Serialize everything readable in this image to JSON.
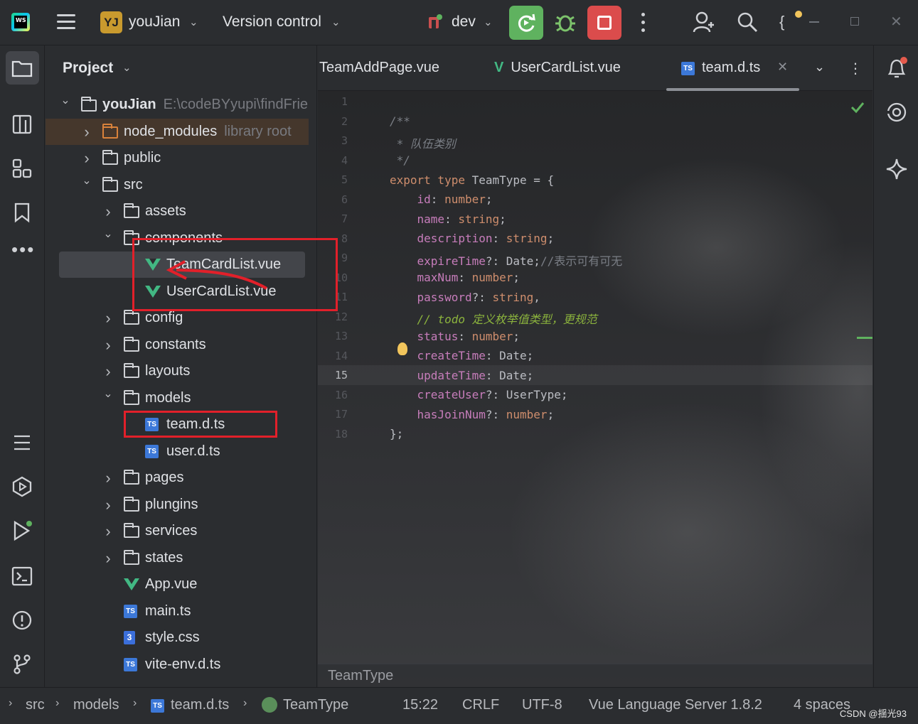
{
  "toolbar": {
    "app_logo_text": "WS",
    "project_badge": "YJ",
    "project_name": "youJian",
    "vcs_label": "Version control",
    "branch": "dev"
  },
  "project_panel": {
    "title": "Project",
    "tree": [
      {
        "label": "youJian",
        "hint": "E:\\codeBYyupi\\findFrie",
        "kind": "folder",
        "expanded": true,
        "bold": true
      },
      {
        "label": "node_modules",
        "hint": "library root",
        "kind": "folder-orange",
        "expanded": false
      },
      {
        "label": "public",
        "kind": "folder",
        "expanded": false
      },
      {
        "label": "src",
        "kind": "folder",
        "expanded": true
      },
      {
        "label": "assets",
        "kind": "folder",
        "expanded": false
      },
      {
        "label": "components",
        "kind": "folder",
        "expanded": true
      },
      {
        "label": "TeamCardList.vue",
        "kind": "vue"
      },
      {
        "label": "UserCardList.vue",
        "kind": "vue"
      },
      {
        "label": "config",
        "kind": "folder",
        "expanded": false
      },
      {
        "label": "constants",
        "kind": "folder",
        "expanded": false
      },
      {
        "label": "layouts",
        "kind": "folder",
        "expanded": false
      },
      {
        "label": "models",
        "kind": "folder",
        "expanded": true
      },
      {
        "label": "team.d.ts",
        "kind": "ts"
      },
      {
        "label": "user.d.ts",
        "kind": "ts"
      },
      {
        "label": "pages",
        "kind": "folder",
        "expanded": false
      },
      {
        "label": "plungins",
        "kind": "folder",
        "expanded": false
      },
      {
        "label": "services",
        "kind": "folder",
        "expanded": false
      },
      {
        "label": "states",
        "kind": "folder",
        "expanded": false
      },
      {
        "label": "App.vue",
        "kind": "vue"
      },
      {
        "label": "main.ts",
        "kind": "ts"
      },
      {
        "label": "style.css",
        "kind": "css"
      },
      {
        "label": "vite-env.d.ts",
        "kind": "ts"
      }
    ]
  },
  "editor": {
    "tabs": [
      {
        "label": "TeamAddPage.vue",
        "kind": "vue"
      },
      {
        "label": "UserCardList.vue",
        "kind": "vue"
      },
      {
        "label": "team.d.ts",
        "kind": "ts",
        "active": true
      }
    ],
    "line_numbers": [
      "1",
      "2",
      "3",
      "4",
      "5",
      "6",
      "7",
      "8",
      "9",
      "10",
      "11",
      "12",
      "13",
      "14",
      "15",
      "16",
      "17",
      "18"
    ],
    "current_line": "15",
    "code": {
      "l2": "/**",
      "l3_a": " * ",
      "l3_b": "队伍类别",
      "l4": " */",
      "l5_kw": "export type ",
      "l5_rest": "TeamType = {",
      "l6_p": "id",
      "l6_t": "number",
      "l7_p": "name",
      "l7_t": "string",
      "l8_p": "description",
      "l8_t": "string",
      "l9_p": "expireTime",
      "l9_t": "Date",
      "l9_c": "//表示可有可无",
      "l10_p": "maxNum",
      "l10_t": "number",
      "l11_p": "password",
      "l11_t": "string",
      "l12": "// todo 定义枚举值类型，更规范",
      "l13_p": "status",
      "l13_t": "number",
      "l14_p": "createTime",
      "l14_t": "Date",
      "l15_p": "updateTime",
      "l15_t": "Date",
      "l16_p": "createUser",
      "l16_t": "UserType",
      "l17_p": "hasJoinNum",
      "l17_t": "number",
      "l18": "};"
    },
    "breadcrumb": "TeamType"
  },
  "status_bar": {
    "path": [
      "src",
      "models",
      "team.d.ts",
      "TeamType"
    ],
    "position": "15:22",
    "line_sep": "CRLF",
    "encoding": "UTF-8",
    "language_server": "Vue Language Server 1.8.2",
    "indent": "4 spaces",
    "watermark": "CSDN @揺光93"
  },
  "colors": {
    "run": "#5fb25f",
    "stop": "#db4c4c",
    "annotation": "#e2202a",
    "vue": "#42b883",
    "ts": "#3c78d8"
  }
}
